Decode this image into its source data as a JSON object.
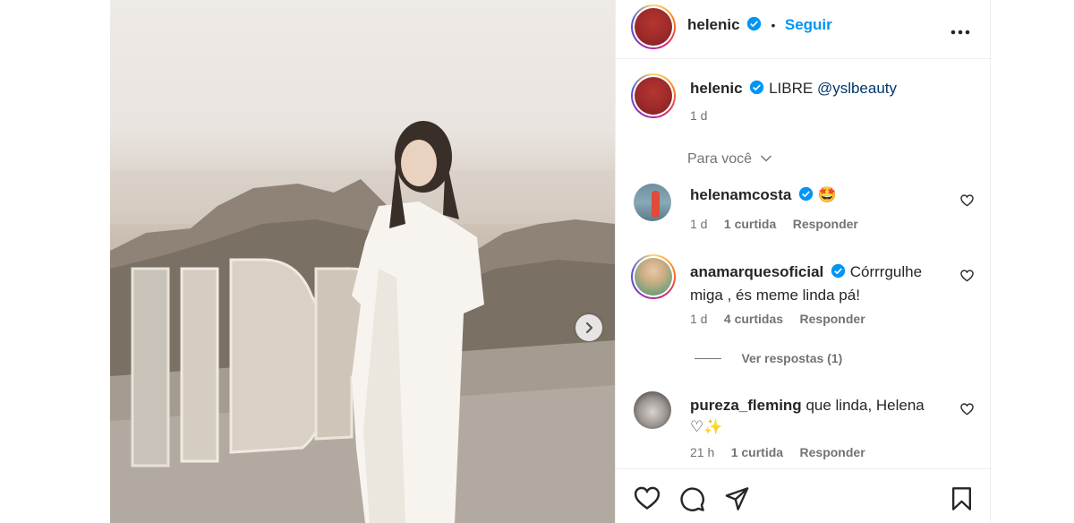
{
  "post": {
    "author": "helenic",
    "follow_label": "Seguir",
    "separator": "•",
    "caption_text": "LIBRE",
    "caption_mention": "@yslbeauty",
    "caption_time": "1 d"
  },
  "comments_filter": {
    "label": "Para você"
  },
  "comments": [
    {
      "user": "helenamcosta",
      "text": "🤩",
      "time": "1 d",
      "likes": "1 curtida",
      "reply": "Responder"
    },
    {
      "user": "anamarquesoficial",
      "text_line1": "Córrrgulhe",
      "text_line2": "miga , és meme linda pá!",
      "time": "1 d",
      "likes": "4 curtidas",
      "reply": "Responder",
      "view_replies": "Ver respostas (1)"
    },
    {
      "user": "pureza_fleming",
      "text_line1": "que linda, Helena",
      "text_line2": "♡✨",
      "time": "21 h",
      "likes": "1 curtida",
      "reply": "Responder"
    }
  ],
  "media": {
    "sign_text": "LIBRE"
  },
  "icons": {
    "verified": "verified-badge-icon",
    "more": "more-options-icon",
    "chevron": "chevron-down-icon",
    "like": "heart-icon",
    "comment": "comment-icon",
    "share": "share-icon",
    "save": "bookmark-icon",
    "next": "chevron-right-icon"
  },
  "colors": {
    "accent": "#0095f6",
    "verified": "#0095f6",
    "text": "#262626",
    "muted": "#737373"
  }
}
